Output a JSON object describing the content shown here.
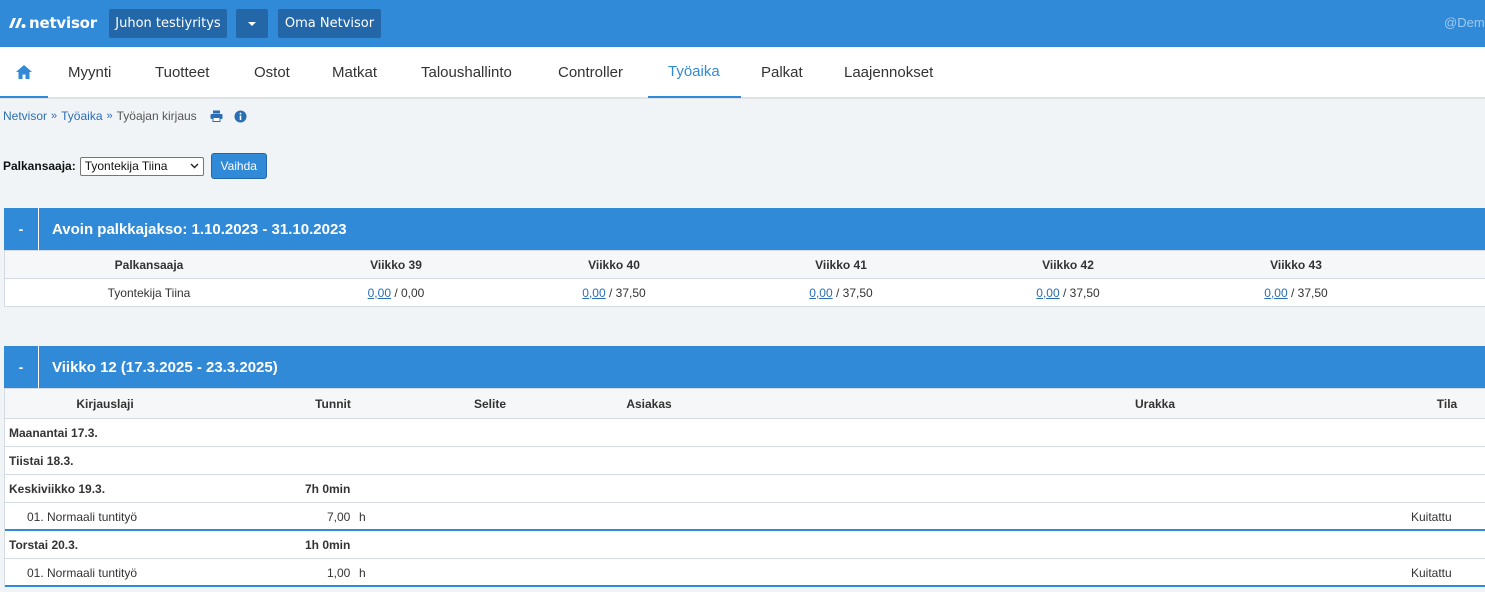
{
  "app": {
    "logo_text": "netvisor",
    "company_button": "Juhon testiyritys",
    "oma_button": "Oma Netvisor",
    "user_tag": "@Dem"
  },
  "nav": {
    "items": [
      "Myynti",
      "Tuotteet",
      "Ostot",
      "Matkat",
      "Taloushallinto",
      "Controller",
      "Työaika",
      "Palkat",
      "Laajennokset"
    ],
    "active": "Työaika"
  },
  "breadcrumb": {
    "items": [
      "Netvisor",
      "Työaika",
      "Työajan kirjaus"
    ],
    "separator": "»"
  },
  "selector": {
    "label": "Palkansaaja:",
    "selected": "Tyontekija Tiina",
    "button": "Vaihda"
  },
  "period_panel": {
    "toggle": "-",
    "title": "Avoin palkkajakso: 1.10.2023 - 31.10.2023",
    "columns": [
      "Palkansaaja",
      "Viikko 39",
      "Viikko 40",
      "Viikko 41",
      "Viikko 42",
      "Viikko 43"
    ],
    "rows": [
      {
        "name": "Tyontekija Tiina",
        "weeks": [
          {
            "entered": "0,00",
            "total": "/ 0,00"
          },
          {
            "entered": "0,00",
            "total": "/ 37,50"
          },
          {
            "entered": "0,00",
            "total": "/ 37,50"
          },
          {
            "entered": "0,00",
            "total": "/ 37,50"
          },
          {
            "entered": "0,00",
            "total": "/ 37,50"
          }
        ]
      }
    ]
  },
  "week_panel": {
    "toggle": "-",
    "title": "Viikko 12 (17.3.2025 - 23.3.2025)",
    "columns": {
      "kirjauslaji": "Kirjauslaji",
      "tunnit": "Tunnit",
      "selite": "Selite",
      "asiakas": "Asiakas",
      "urakka": "Urakka",
      "tila": "Tila"
    },
    "rows": [
      {
        "type": "day",
        "label": "Maanantai 17.3.",
        "hours": ""
      },
      {
        "type": "day",
        "label": "Tiistai 18.3.",
        "hours": ""
      },
      {
        "type": "day",
        "label": "Keskiviikko 19.3.",
        "hours": "7h 0min"
      },
      {
        "type": "entry",
        "label": "01. Normaali tuntityö",
        "amount": "7,00",
        "unit": "h",
        "status": "Kuitattu"
      },
      {
        "type": "day",
        "label": "Torstai 20.3.",
        "hours": "1h 0min"
      },
      {
        "type": "entry",
        "label": "01. Normaali tuntityö",
        "amount": "1,00",
        "unit": "h",
        "status": "Kuitattu"
      }
    ]
  },
  "colors": {
    "brand_blue": "#318ad8",
    "dark_button": "#2467a8",
    "link": "#2b6fb3",
    "background": "#f1f4f7"
  }
}
